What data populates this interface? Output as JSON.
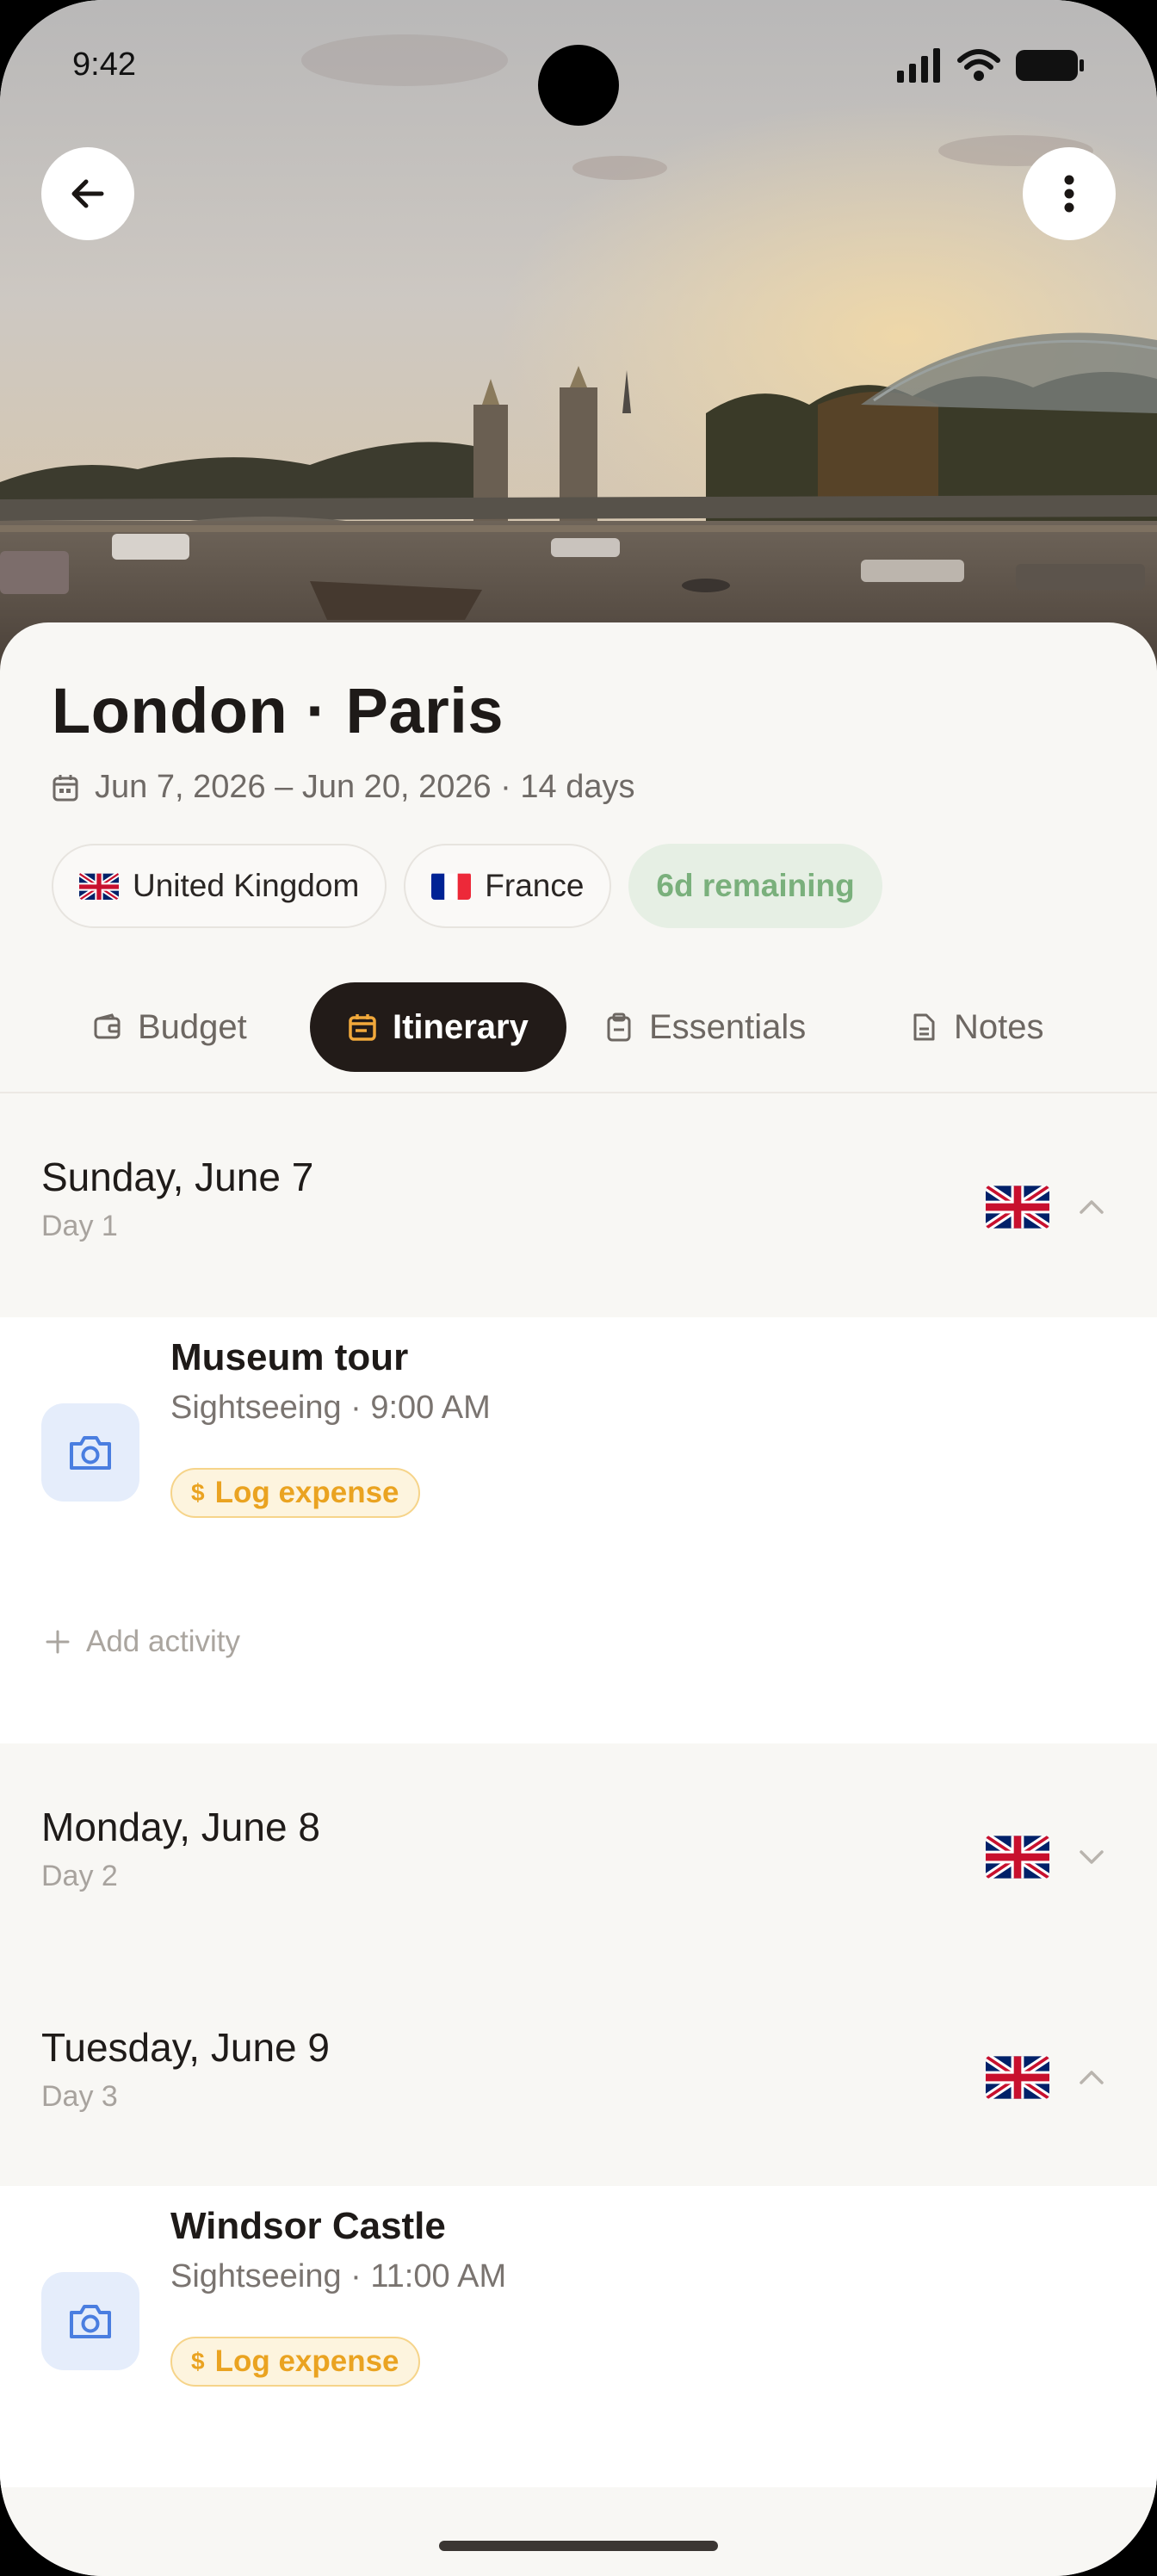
{
  "status_bar": {
    "time": "9:42"
  },
  "hero": {
    "image": "paris-seine-sunset-photo"
  },
  "trip": {
    "title": "London · Paris",
    "dates": "Jun 7, 2026 – Jun 20, 2026 · 14 days",
    "chips": [
      {
        "label": "United Kingdom",
        "flag": "uk-flag-icon"
      },
      {
        "label": "France",
        "flag": "france-flag-icon"
      },
      {
        "label": "6d remaining"
      }
    ]
  },
  "tabs": [
    {
      "label": "Budget",
      "icon": "wallet-icon",
      "active": false
    },
    {
      "label": "Itinerary",
      "icon": "calendar-icon",
      "active": true
    },
    {
      "label": "Essentials",
      "icon": "clipboard-icon",
      "active": false
    },
    {
      "label": "Notes",
      "icon": "document-icon",
      "active": false
    }
  ],
  "days": [
    {
      "title": "Sunday, June 7",
      "subtitle": "Day 1",
      "expanded": true,
      "activities": [
        {
          "name": "Museum tour",
          "meta": "Sightseeing · 9:00 AM",
          "action": "Log expense",
          "icon": "camera-icon"
        }
      ],
      "add_label": "Add activity"
    },
    {
      "title": "Monday, June 8",
      "subtitle": "Day 2",
      "expanded": false
    },
    {
      "title": "Tuesday, June 9",
      "subtitle": "Day 3",
      "expanded": true,
      "activities": [
        {
          "name": "Windsor Castle",
          "meta": "Sightseeing · 11:00 AM",
          "action": "Log expense",
          "icon": "camera-icon"
        }
      ]
    }
  ],
  "colors": {
    "accent_dark": "#221b18",
    "log_expense": "#eaa321",
    "remaining_green": "#7ab07c",
    "activity_icon_bg": "#e5edfb",
    "activity_icon": "#4a7ee0"
  }
}
